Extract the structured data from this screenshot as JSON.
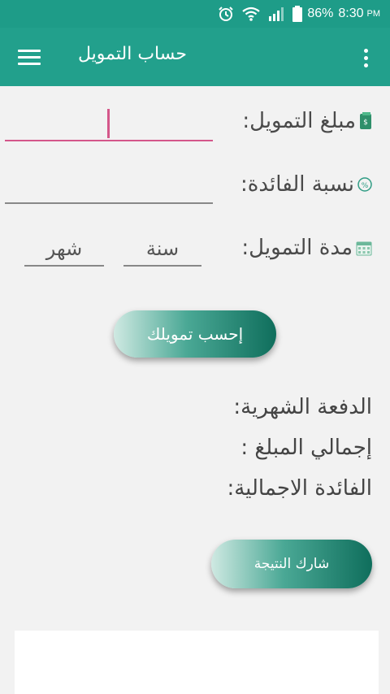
{
  "status": {
    "battery": "86%",
    "time": "8:30",
    "ampm": "PM"
  },
  "appbar": {
    "title": "حساب التمويل"
  },
  "form": {
    "amount_label": "مبلغ التمويل:",
    "amount_value": "",
    "rate_label": "نسبة الفائدة:",
    "rate_value": "",
    "duration_label": "مدة التمويل:",
    "year_placeholder": "سنة",
    "month_placeholder": "شهر"
  },
  "calculate_button": "إحسب تمويلك",
  "results": {
    "monthly_payment": "الدفعة الشهرية:",
    "total_amount": "إجمالي المبلغ :",
    "total_interest": "الفائدة الاجمالية:"
  },
  "share_button": "شارك النتيجة",
  "colors": {
    "primary": "#22a08c",
    "accent": "#d4578a",
    "button_dark": "#0f6e5c"
  }
}
